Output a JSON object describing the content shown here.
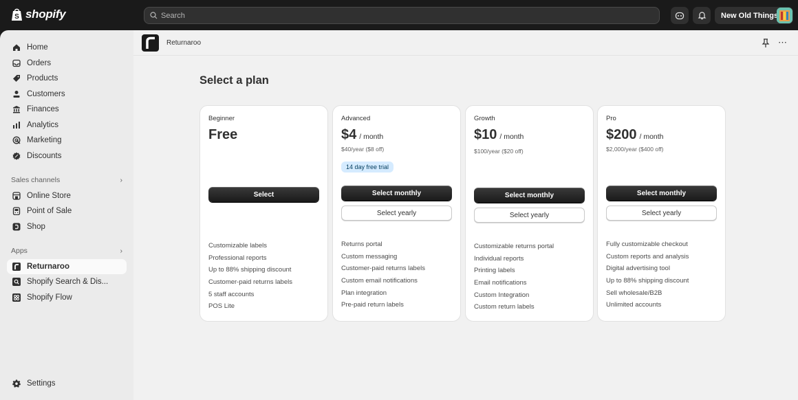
{
  "topbar": {
    "logo_text": "shopify",
    "search_placeholder": "Search",
    "store_name": "New Old Things"
  },
  "sidebar": {
    "main_items": [
      {
        "label": "Home",
        "icon": "home-icon"
      },
      {
        "label": "Orders",
        "icon": "inbox-icon"
      },
      {
        "label": "Products",
        "icon": "tag-icon"
      },
      {
        "label": "Customers",
        "icon": "person-icon"
      },
      {
        "label": "Finances",
        "icon": "bank-icon"
      },
      {
        "label": "Analytics",
        "icon": "bar-chart-icon"
      },
      {
        "label": "Marketing",
        "icon": "target-icon"
      },
      {
        "label": "Discounts",
        "icon": "discount-icon"
      }
    ],
    "sales_channels_label": "Sales channels",
    "sales_channels": [
      {
        "label": "Online Store",
        "icon": "store-icon"
      },
      {
        "label": "Point of Sale",
        "icon": "pos-icon"
      },
      {
        "label": "Shop",
        "icon": "shop-icon"
      }
    ],
    "apps_label": "Apps",
    "apps": [
      {
        "label": "Returnaroo",
        "icon": "returnaroo-icon",
        "active": true
      },
      {
        "label": "Shopify Search & Dis...",
        "icon": "search-discovery-icon"
      },
      {
        "label": "Shopify Flow",
        "icon": "flow-icon"
      }
    ],
    "settings_label": "Settings"
  },
  "app_header": {
    "app_name": "Returnaroo"
  },
  "page": {
    "title": "Select a plan",
    "plans": [
      {
        "name": "Beginner",
        "price": "Free",
        "unit": "",
        "yearly": "",
        "trial": "",
        "primary_label": "Select",
        "secondary_label": "",
        "features": [
          "Customizable labels",
          "Professional reports",
          "Up to 88% shipping discount",
          "Customer-paid returns labels",
          "5 staff accounts",
          "POS Lite"
        ]
      },
      {
        "name": "Advanced",
        "price": "$4",
        "unit": "/ month",
        "yearly": "$40/year ($8 off)",
        "trial": "14 day free trial",
        "primary_label": "Select monthly",
        "secondary_label": "Select yearly",
        "features": [
          "Returns portal",
          "Custom messaging",
          "Customer-paid returns labels",
          "Custom email notifications",
          "Plan integration",
          "Pre-paid return labels"
        ]
      },
      {
        "name": "Growth",
        "price": "$10",
        "unit": "/ month",
        "yearly": "$100/year ($20 off)",
        "trial": "",
        "primary_label": "Select monthly",
        "secondary_label": "Select yearly",
        "features": [
          "Customizable returns portal",
          "Individual reports",
          "Printing labels",
          "Email notifications",
          "Custom Integration",
          "Custom return labels"
        ]
      },
      {
        "name": "Pro",
        "price": "$200",
        "unit": "/ month",
        "yearly": "$2,000/year ($400 off)",
        "trial": "",
        "primary_label": "Select monthly",
        "secondary_label": "Select yearly",
        "features": [
          "Fully customizable checkout",
          "Custom reports and analysis",
          "Digital advertising tool",
          "Up to 88% shipping discount",
          "Sell wholesale/B2B",
          "Unlimited accounts"
        ]
      }
    ]
  }
}
